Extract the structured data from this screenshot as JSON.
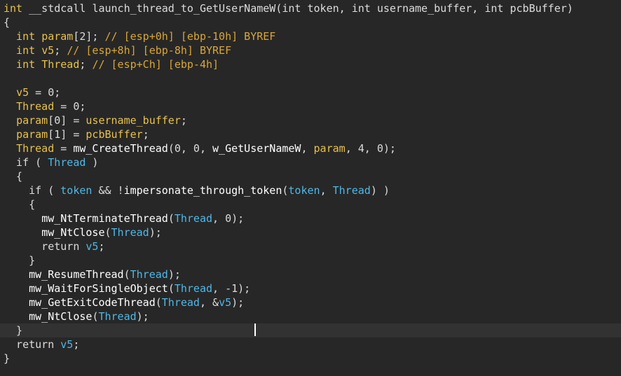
{
  "editor": {
    "lines": [
      [
        {
          "t": "int ",
          "c": "type"
        },
        {
          "t": "__stdcall ",
          "c": "plain"
        },
        {
          "t": "launch_thread_to_GetUserNameW",
          "c": "plain"
        },
        {
          "t": "(int token, int username_buffer, int pcbBuffer)",
          "c": "plain"
        }
      ],
      [
        {
          "t": "{",
          "c": "plain"
        }
      ],
      [
        {
          "t": "  int ",
          "c": "type"
        },
        {
          "t": "param",
          "c": "var"
        },
        {
          "t": "[2]; ",
          "c": "plain"
        },
        {
          "t": "// [esp+0h] [ebp-10h] BYREF",
          "c": "comment-var"
        }
      ],
      [
        {
          "t": "  int ",
          "c": "type"
        },
        {
          "t": "v5",
          "c": "var"
        },
        {
          "t": "; ",
          "c": "plain"
        },
        {
          "t": "// [esp+8h] [ebp-8h] BYREF",
          "c": "comment-var"
        }
      ],
      [
        {
          "t": "  int ",
          "c": "type"
        },
        {
          "t": "Thread",
          "c": "var"
        },
        {
          "t": "; ",
          "c": "plain"
        },
        {
          "t": "// [esp+Ch] [ebp-4h]",
          "c": "comment-var"
        }
      ],
      [
        {
          "t": "",
          "c": "plain"
        }
      ],
      [
        {
          "t": "  ",
          "c": "plain"
        },
        {
          "t": "v5",
          "c": "var"
        },
        {
          "t": " = 0;",
          "c": "plain"
        }
      ],
      [
        {
          "t": "  ",
          "c": "plain"
        },
        {
          "t": "Thread",
          "c": "var"
        },
        {
          "t": " = 0;",
          "c": "plain"
        }
      ],
      [
        {
          "t": "  ",
          "c": "plain"
        },
        {
          "t": "param",
          "c": "var"
        },
        {
          "t": "[0] = ",
          "c": "plain"
        },
        {
          "t": "username_buffer",
          "c": "var"
        },
        {
          "t": ";",
          "c": "plain"
        }
      ],
      [
        {
          "t": "  ",
          "c": "plain"
        },
        {
          "t": "param",
          "c": "var"
        },
        {
          "t": "[1] = ",
          "c": "plain"
        },
        {
          "t": "pcbBuffer",
          "c": "var"
        },
        {
          "t": ";",
          "c": "plain"
        }
      ],
      [
        {
          "t": "  ",
          "c": "plain"
        },
        {
          "t": "Thread",
          "c": "var"
        },
        {
          "t": " = ",
          "c": "plain"
        },
        {
          "t": "mw_CreateThread",
          "c": "func"
        },
        {
          "t": "(0, 0, ",
          "c": "plain"
        },
        {
          "t": "w_GetUserNameW",
          "c": "func"
        },
        {
          "t": ", ",
          "c": "plain"
        },
        {
          "t": "param",
          "c": "var"
        },
        {
          "t": ", 4, 0);",
          "c": "plain"
        }
      ],
      [
        {
          "t": "  if ( ",
          "c": "kw"
        },
        {
          "t": "Thread",
          "c": "glob"
        },
        {
          "t": " )",
          "c": "plain"
        }
      ],
      [
        {
          "t": "  {",
          "c": "plain"
        }
      ],
      [
        {
          "t": "    if ( ",
          "c": "kw"
        },
        {
          "t": "token",
          "c": "glob"
        },
        {
          "t": " && !",
          "c": "plain"
        },
        {
          "t": "impersonate_through_token",
          "c": "func"
        },
        {
          "t": "(",
          "c": "plain"
        },
        {
          "t": "token",
          "c": "glob"
        },
        {
          "t": ", ",
          "c": "plain"
        },
        {
          "t": "Thread",
          "c": "glob"
        },
        {
          "t": ") )",
          "c": "plain"
        }
      ],
      [
        {
          "t": "    {",
          "c": "plain"
        }
      ],
      [
        {
          "t": "      ",
          "c": "plain"
        },
        {
          "t": "mw_NtTerminateThread",
          "c": "func"
        },
        {
          "t": "(",
          "c": "plain"
        },
        {
          "t": "Thread",
          "c": "glob"
        },
        {
          "t": ", 0);",
          "c": "plain"
        }
      ],
      [
        {
          "t": "      ",
          "c": "plain"
        },
        {
          "t": "mw_NtClose",
          "c": "func"
        },
        {
          "t": "(",
          "c": "plain"
        },
        {
          "t": "Thread",
          "c": "glob"
        },
        {
          "t": ");",
          "c": "plain"
        }
      ],
      [
        {
          "t": "      return ",
          "c": "kw"
        },
        {
          "t": "v5",
          "c": "glob"
        },
        {
          "t": ";",
          "c": "plain"
        }
      ],
      [
        {
          "t": "    }",
          "c": "plain"
        }
      ],
      [
        {
          "t": "    ",
          "c": "plain"
        },
        {
          "t": "mw_ResumeThread",
          "c": "func"
        },
        {
          "t": "(",
          "c": "plain"
        },
        {
          "t": "Thread",
          "c": "glob"
        },
        {
          "t": ");",
          "c": "plain"
        }
      ],
      [
        {
          "t": "    ",
          "c": "plain"
        },
        {
          "t": "mw_WaitForSingleObject",
          "c": "func"
        },
        {
          "t": "(",
          "c": "plain"
        },
        {
          "t": "Thread",
          "c": "glob"
        },
        {
          "t": ", -1);",
          "c": "plain"
        }
      ],
      [
        {
          "t": "    ",
          "c": "plain"
        },
        {
          "t": "mw_GetExitCodeThread",
          "c": "func"
        },
        {
          "t": "(",
          "c": "plain"
        },
        {
          "t": "Thread",
          "c": "glob"
        },
        {
          "t": ", &",
          "c": "plain"
        },
        {
          "t": "v5",
          "c": "glob"
        },
        {
          "t": ");",
          "c": "plain"
        }
      ],
      [
        {
          "t": "    ",
          "c": "plain"
        },
        {
          "t": "mw_NtClose",
          "c": "func"
        },
        {
          "t": "(",
          "c": "plain"
        },
        {
          "t": "Thread",
          "c": "glob"
        },
        {
          "t": ");",
          "c": "plain"
        }
      ],
      [
        {
          "t": "  }",
          "c": "plain"
        }
      ],
      [
        {
          "t": "  return ",
          "c": "kw"
        },
        {
          "t": "v5",
          "c": "glob"
        },
        {
          "t": ";",
          "c": "plain"
        }
      ],
      [
        {
          "t": "}",
          "c": "plain"
        }
      ]
    ],
    "current_line_index": 23
  }
}
